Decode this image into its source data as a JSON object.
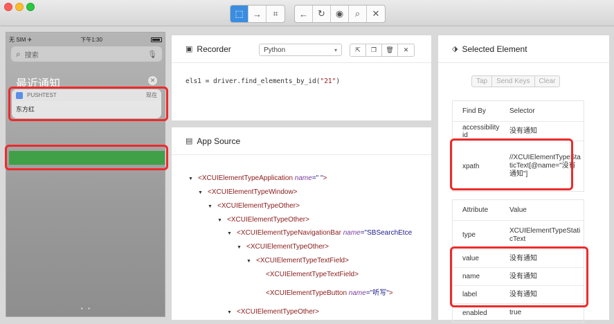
{
  "toolbar": {
    "mode_icons": [
      "select-icon",
      "swipe-arrow-icon",
      "tap-coordinates-icon"
    ],
    "nav_icons": [
      "back-arrow-icon",
      "refresh-icon",
      "eye-icon",
      "search-icon",
      "close-icon"
    ]
  },
  "device": {
    "carrier": "无 SIM ✈",
    "time": "下午1:30",
    "search_placeholder": "搜索",
    "section_title": "最近通知",
    "notification": {
      "app_name": "PUSHTEST",
      "time": "现在",
      "body": "东方红"
    },
    "page_dots": "• •"
  },
  "recorder": {
    "title": "Recorder",
    "language": "Python",
    "code_prefix": "els1 = driver.find_elements_by_id(",
    "code_arg": "\"21\"",
    "code_suffix": ")"
  },
  "app_source": {
    "title": "App Source",
    "nodes": [
      {
        "tag": "<XCUIElementTypeApplication",
        "attr": " name",
        "value": "=\" \"",
        "end": ">"
      },
      {
        "tag": "<XCUIElementTypeWindow>",
        "attr": "",
        "value": "",
        "end": ""
      },
      {
        "tag": "<XCUIElementTypeOther>",
        "attr": "",
        "value": "",
        "end": ""
      },
      {
        "tag": "<XCUIElementTypeOther>",
        "attr": "",
        "value": "",
        "end": ""
      },
      {
        "tag": "<XCUIElementTypeNavigationBar",
        "attr": " name",
        "value": "=\"SBSearchEtce",
        "end": ""
      },
      {
        "tag": "<XCUIElementTypeOther>",
        "attr": "",
        "value": "",
        "end": ""
      },
      {
        "tag": "<XCUIElementTypeTextField>",
        "attr": "",
        "value": "",
        "end": ""
      },
      {
        "tag": "<XCUIElementTypeTextField>",
        "attr": "",
        "value": "",
        "end": ""
      },
      {
        "tag": "<XCUIElementTypeButton",
        "attr": " name",
        "value": "=\"听写\"",
        "end": ">"
      },
      {
        "tag": "<XCUIElementTypeOther>",
        "attr": "",
        "value": "",
        "end": ""
      }
    ]
  },
  "selected_element": {
    "title": "Selected Element",
    "actions": [
      "Tap",
      "Send Keys",
      "Clear"
    ],
    "find_by_header": [
      "Find By",
      "Selector"
    ],
    "find_by_rows": [
      {
        "key": "accessibility id",
        "value": "没有通知"
      },
      {
        "key": "xpath",
        "value": "//XCUIElementTypeStaticText[@name=\"没有通知\"]"
      }
    ],
    "attr_header": [
      "Attribute",
      "Value"
    ],
    "attr_rows": [
      {
        "key": "type",
        "value": "XCUIElementTypeStaticText"
      },
      {
        "key": "value",
        "value": "没有通知"
      },
      {
        "key": "name",
        "value": "没有通知"
      },
      {
        "key": "label",
        "value": "没有通知"
      },
      {
        "key": "enabled",
        "value": "true"
      }
    ]
  },
  "colors": {
    "accent": "#3a8de0",
    "highlight_red": "#ec2b2b",
    "selected_green": "#3fa048"
  }
}
